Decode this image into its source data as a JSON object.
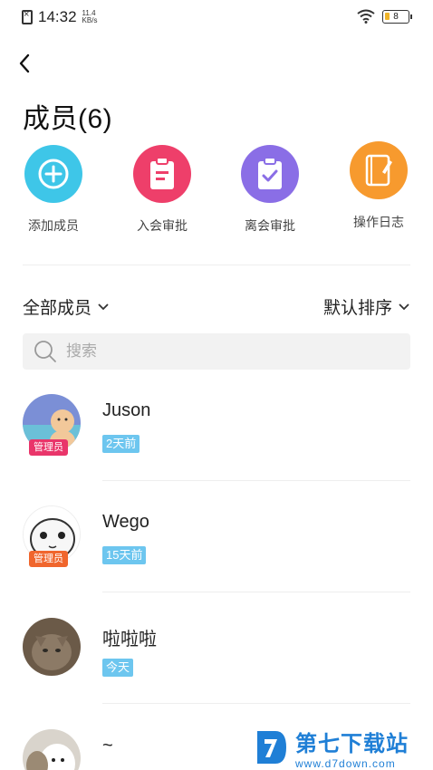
{
  "status_bar": {
    "time": "14:32",
    "speed_value": "11.4",
    "speed_unit": "KB/s",
    "battery": "8"
  },
  "header": {
    "title": "成员(6)"
  },
  "actions": [
    {
      "label": "添加成员",
      "icon": "plus-icon",
      "color": "#3ec6e8"
    },
    {
      "label": "入会审批",
      "icon": "clipboard-list-icon",
      "color": "#ee3f6a"
    },
    {
      "label": "离会审批",
      "icon": "clipboard-check-icon",
      "color": "#8a6ee6"
    },
    {
      "label": "操作日志",
      "icon": "notebook-pen-icon",
      "color": "#f79a2e"
    }
  ],
  "filters": {
    "scope": "全部成员",
    "sort": "默认排序"
  },
  "search": {
    "placeholder": "搜索"
  },
  "members": [
    {
      "name": "Juson",
      "time": "2天前",
      "role": "管理员",
      "role_color": "#e9356a"
    },
    {
      "name": "Wego",
      "time": "15天前",
      "role": "管理员",
      "role_color": "#f0662d"
    },
    {
      "name": "啦啦啦",
      "time": "今天"
    },
    {
      "name": "~"
    }
  ],
  "watermark": {
    "title": "第七下载站",
    "url": "www.d7down.com"
  }
}
